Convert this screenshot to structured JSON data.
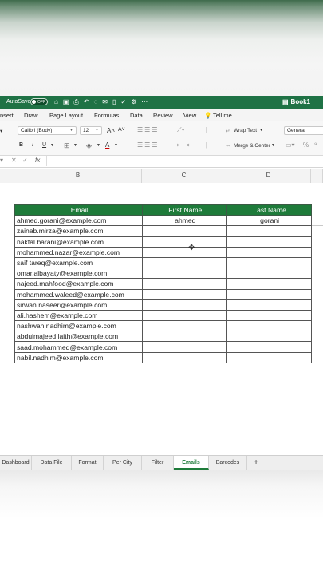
{
  "titlebar": {
    "autosave_label": "AutoSave",
    "autosave_state": "OFF",
    "book_name": "Book1"
  },
  "menu": [
    "nsert",
    "Draw",
    "Page Layout",
    "Formulas",
    "Data",
    "Review",
    "View",
    "Tell me"
  ],
  "ribbon": {
    "font_name": "Calibri (Body)",
    "font_size": "12",
    "wrap_text": "Wrap Text",
    "merge_center": "Merge & Center",
    "number_format": "General",
    "bold": "B",
    "italic": "I",
    "underline": "U",
    "grow_font": "A˄",
    "shrink_font": "A˅",
    "percent": "%"
  },
  "formula_bar": {
    "fx": "fx"
  },
  "columns": [
    "B",
    "C",
    "D"
  ],
  "table": {
    "headers": [
      "Email",
      "First Name",
      "Last Name"
    ],
    "rows": [
      [
        "ahmed.gorani@example.com",
        "ahmed",
        "gorani"
      ],
      [
        "zainab.mirza@example.com",
        "",
        ""
      ],
      [
        "naktal.barani@example.com",
        "",
        ""
      ],
      [
        "mohammed.nazar@example.com",
        "",
        ""
      ],
      [
        "saif tareq@example.com",
        "",
        ""
      ],
      [
        "omar.albayaty@example.com",
        "",
        ""
      ],
      [
        "najeed.mahfood@example.com",
        "",
        ""
      ],
      [
        "mohammed.waleed@example.com",
        "",
        ""
      ],
      [
        "sirwan.naseer@example.com",
        "",
        ""
      ],
      [
        "ali.hashem@example.com",
        "",
        ""
      ],
      [
        "nashwan.nadhim@example.com",
        "",
        ""
      ],
      [
        "abdulmajeed.laith@example.com",
        "",
        ""
      ],
      [
        "saad.mohammed@example.com",
        "",
        ""
      ],
      [
        "nabil.nadhim@example.com",
        "",
        ""
      ]
    ]
  },
  "sheets": [
    "Dashboard",
    "Data File",
    "Format",
    "Per City",
    "Filter",
    "Emails",
    "Barcodes"
  ],
  "active_sheet": "Emails",
  "add_sheet": "+",
  "colors": {
    "excel_green": "#1f7245",
    "header_green": "#1e7b3a"
  }
}
